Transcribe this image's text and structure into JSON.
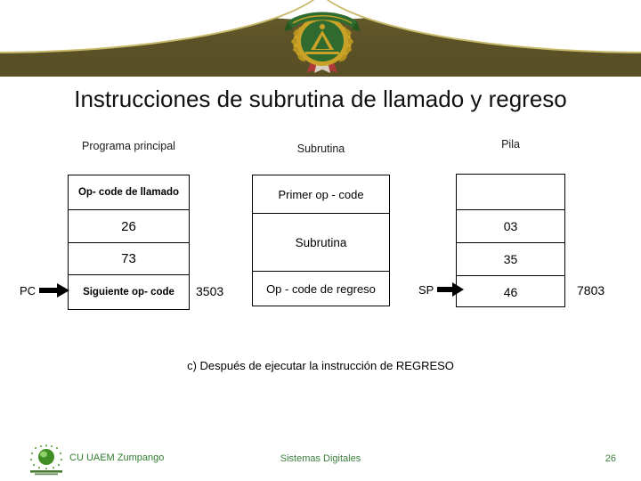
{
  "slide": {
    "title": "Instrucciones de subrutina de llamado y regreso",
    "caption": "c) Después de ejecutar la instrucción de REGRESO"
  },
  "columns": {
    "programa": {
      "heading": "Programa principal",
      "cells": [
        "Op- code de llamado",
        "26",
        "73",
        "Siguiente op- code"
      ],
      "side_value": "3503",
      "pointer_label": "PC"
    },
    "subrutina": {
      "heading": "Subrutina",
      "cells": [
        "Primer op - code",
        "Subrutina",
        "Op - code de regreso"
      ]
    },
    "pila": {
      "heading": "Pila",
      "cells": [
        "",
        "03",
        "35",
        "46"
      ],
      "side_value": "7803",
      "pointer_label": "SP"
    }
  },
  "footer": {
    "institution": "CU UAEM Zumpango",
    "course": "Sistemas Digitales",
    "page": "26"
  },
  "colors": {
    "banner": "#5b5127",
    "banner_highlight": "#c9b96a",
    "crest_green": "#2f6b2f",
    "crest_gold": "#c9a227",
    "footer_text": "#3b7d3b"
  }
}
